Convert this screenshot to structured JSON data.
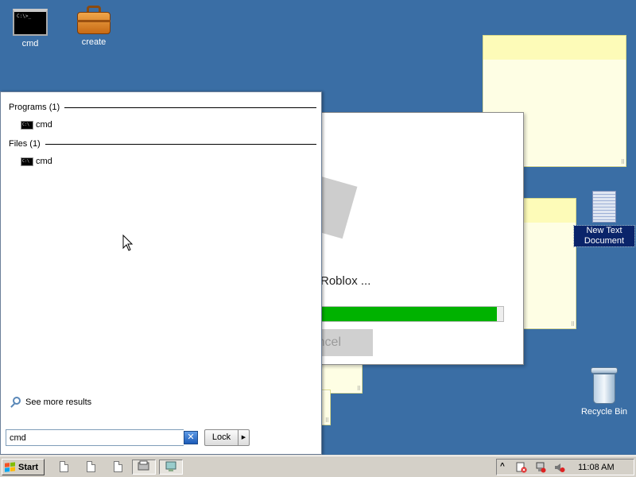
{
  "desktop": {
    "icons": [
      {
        "label": "cmd",
        "icon": "console-icon"
      },
      {
        "label": "create",
        "icon": "briefcase-icon"
      },
      {
        "label": "New Text Document",
        "icon": "text-document-icon"
      },
      {
        "label": "Recycle Bin",
        "icon": "recycle-bin-icon"
      }
    ]
  },
  "cmd_icon_text": "C:\\>_",
  "roblox_dialog": {
    "status": "Roblox ...",
    "progress": 0.97,
    "progress_color": "#00b200",
    "cancel_label": "ncel"
  },
  "start_menu": {
    "groups": [
      {
        "header": "Programs (1)",
        "items": [
          {
            "label": "cmd",
            "icon": "console-icon"
          }
        ]
      },
      {
        "header": "Files (1)",
        "items": [
          {
            "label": "cmd",
            "icon": "console-icon"
          }
        ]
      }
    ],
    "see_more": "See more results",
    "search": {
      "value": "cmd",
      "clear_symbol": "✕"
    },
    "lock_label": "Lock",
    "lock_arrow": "▶"
  },
  "taskbar": {
    "start_label": "Start",
    "clock": "11:08 AM",
    "tray_expand": "^",
    "quick_launch": [
      "document-icon",
      "document-icon",
      "document-icon",
      "printer-icon",
      "network-icon"
    ],
    "tray_icons": [
      "security-alert-icon",
      "network-icon",
      "volume-muted-icon"
    ]
  },
  "colors": {
    "desktop_background": "#3a6ea5",
    "sticky_note": "#fefee4",
    "selection": "#0a246a"
  }
}
